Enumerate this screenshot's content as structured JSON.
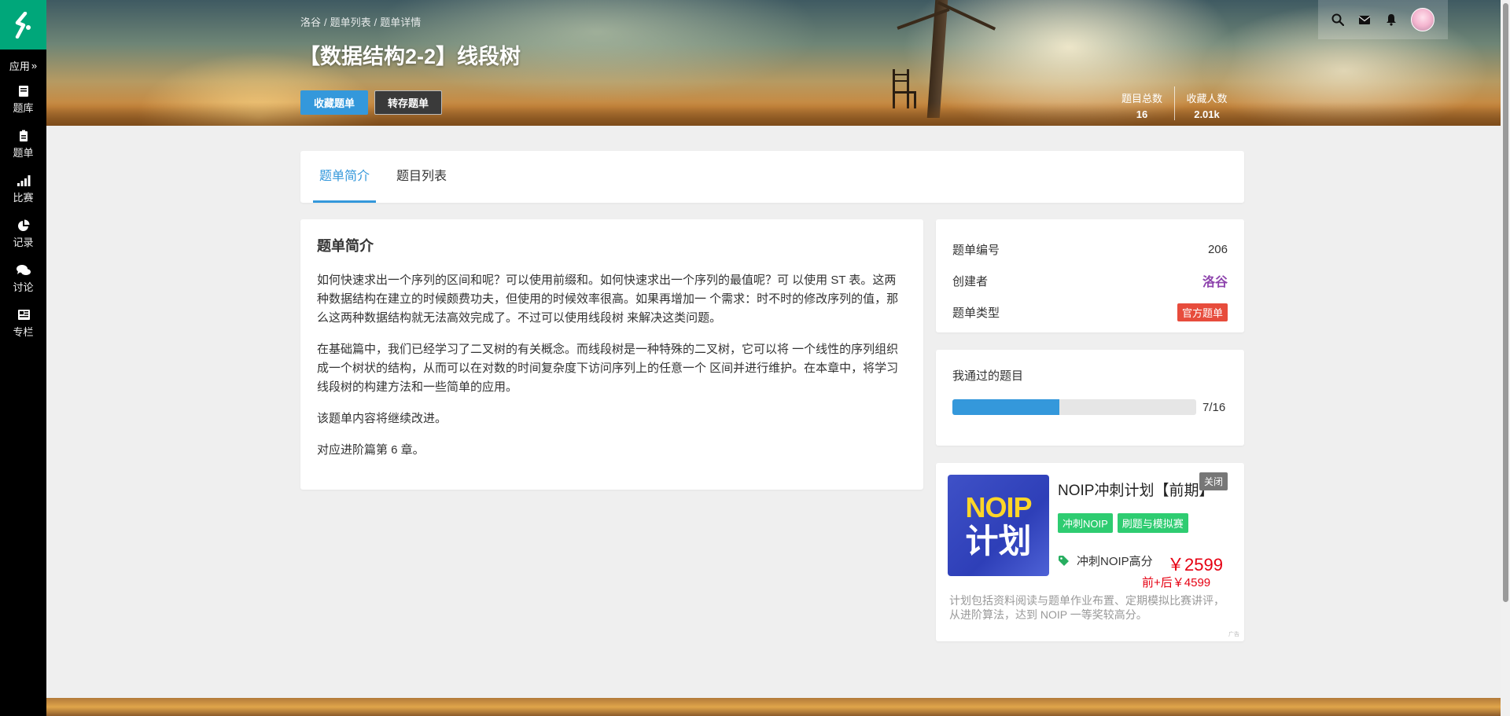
{
  "sidebar": {
    "app_label": "应用",
    "items": [
      {
        "label": "题库",
        "icon": "book-icon"
      },
      {
        "label": "题单",
        "icon": "clipboard-icon"
      },
      {
        "label": "比赛",
        "icon": "signal-bars-icon"
      },
      {
        "label": "记录",
        "icon": "pie-chart-icon"
      },
      {
        "label": "讨论",
        "icon": "chat-bubbles-icon"
      },
      {
        "label": "专栏",
        "icon": "news-icon"
      }
    ]
  },
  "header": {
    "breadcrumb": [
      "洛谷",
      "题单列表",
      "题单详情"
    ],
    "title": "【数据结构2-2】线段树",
    "fav_button": "收藏题单",
    "save_button": "转存题单",
    "stats": [
      {
        "label": "题目总数",
        "value": "16"
      },
      {
        "label": "收藏人数",
        "value": "2.01k"
      }
    ]
  },
  "tabs": [
    {
      "label": "题单简介",
      "active": true
    },
    {
      "label": "题目列表",
      "active": false
    }
  ],
  "intro": {
    "heading": "题单简介",
    "paragraphs": [
      "如何快速求出一个序列的区间和呢？可以使用前缀和。如何快速求出一个序列的最值呢？可 以使用 ST 表。这两种数据结构在建立的时候颇费功夫，但使用的时候效率很高。如果再增加一 个需求：时不时的修改序列的值，那么这两种数据结构就无法高效完成了。不过可以使用线段树 来解决这类问题。",
      "在基础篇中，我们已经学习了二叉树的有关概念。而线段树是一种特殊的二叉树，它可以将 一个线性的序列组织成一个树状的结构，从而可以在对数的时间复杂度下访问序列上的任意一个 区间并进行维护。在本章中，将学习线段树的构建方法和一些简单的应用。",
      "该题单内容将继续改进。",
      "对应进阶篇第 6 章。"
    ]
  },
  "info": {
    "rows": [
      {
        "label": "题单编号",
        "value": "206"
      },
      {
        "label": "创建者",
        "value": "洛谷"
      },
      {
        "label": "题单类型",
        "value": "官方题单"
      }
    ]
  },
  "progress": {
    "title": "我通过的题目",
    "done": 7,
    "total": 16,
    "text": "7/16",
    "fraction": 0.4375
  },
  "ad": {
    "image_text_1": "NOIP",
    "image_text_2": "计划",
    "title": "NOIP冲刺计划【前期】",
    "close": "关闭",
    "tags": [
      "冲刺NOIP",
      "刷题与模拟赛"
    ],
    "price_label": "冲刺NOIP高分",
    "price": "￥2599",
    "price_sub": "前+后￥4599",
    "description": "计划包括资料阅读与题单作业布置、定期模拟比赛讲评，从进阶算法，达到 NOIP 一等奖较高分。",
    "mark": "广告"
  },
  "colors": {
    "accent": "#3498db",
    "brand": "#00a77a",
    "creator": "#8e44ad",
    "official_badge": "#e74c3c",
    "tag_green": "#2ecc71",
    "price_red": "#e60012"
  }
}
